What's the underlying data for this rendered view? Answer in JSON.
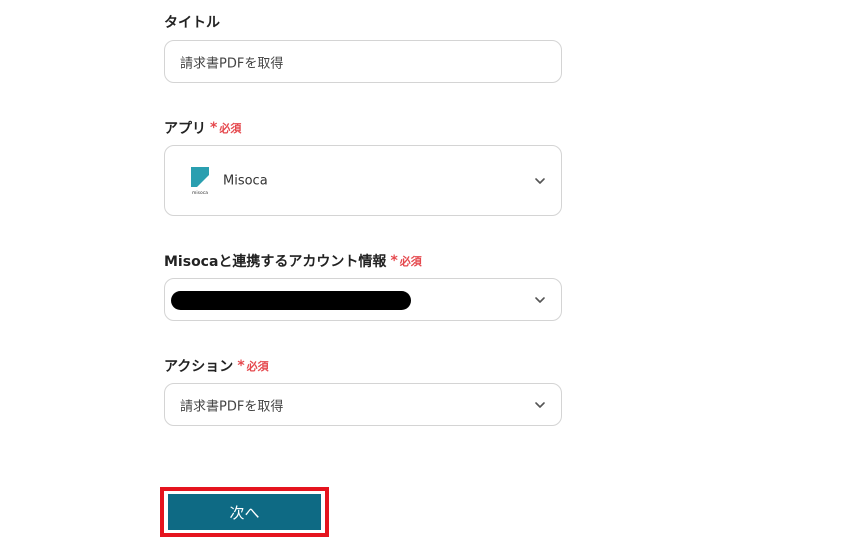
{
  "form": {
    "title_field": {
      "label": "タイトル",
      "value": "請求書PDFを取得"
    },
    "app_field": {
      "label": "アプリ",
      "required_mark": "*",
      "required_text": "必須",
      "value": "Misoca",
      "logo_caption": "misoca",
      "icon": "chevron-down-icon"
    },
    "account_field": {
      "label": "Misocaと連携するアカウント情報",
      "required_mark": "*",
      "required_text": "必須",
      "icon": "chevron-down-icon"
    },
    "action_field": {
      "label": "アクション",
      "required_mark": "*",
      "required_text": "必須",
      "value": "請求書PDFを取得",
      "icon": "chevron-down-icon"
    },
    "next_button": {
      "label": "次へ"
    }
  },
  "colors": {
    "required": "#e5484d",
    "primary_button": "#0e6a84",
    "highlight_border": "#e5141e",
    "field_border": "#d4d4d4",
    "misoca_logo": "#2a9fb0"
  }
}
